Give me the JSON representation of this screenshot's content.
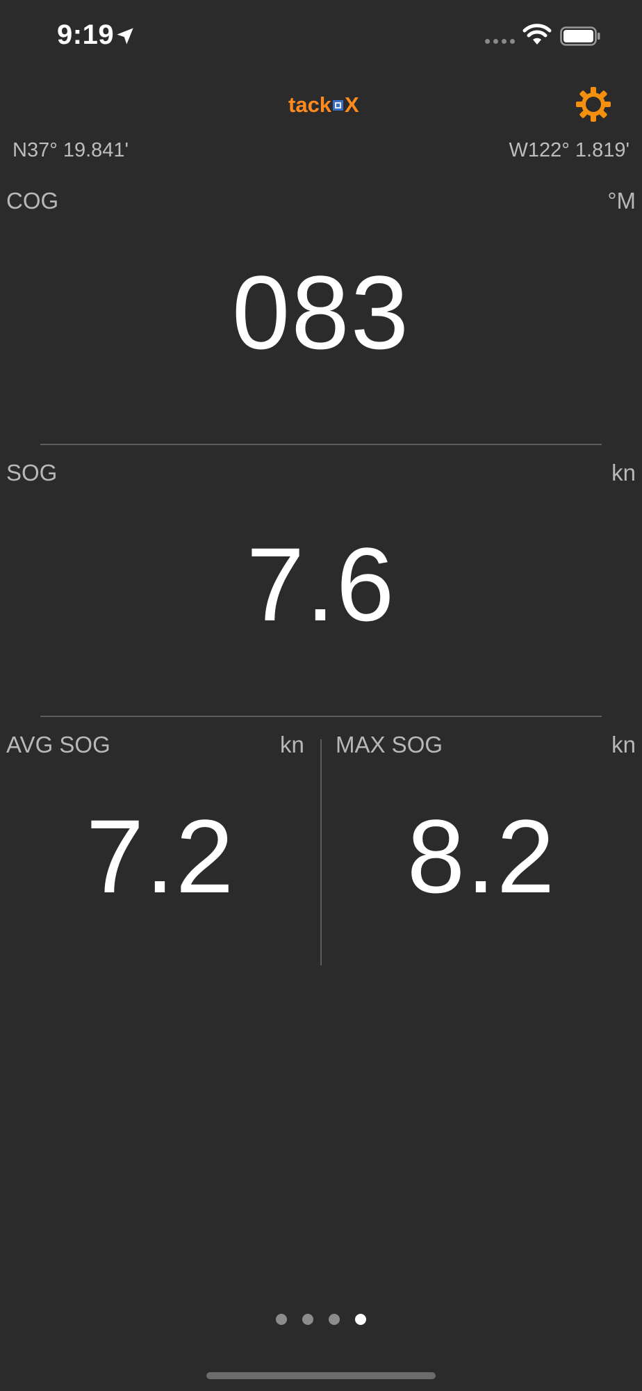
{
  "status_bar": {
    "time": "9:19",
    "location_icon": "location-arrow-icon",
    "wifi_icon": "wifi-icon",
    "battery_icon": "battery-icon"
  },
  "header": {
    "logo_left": "tack",
    "logo_right": "X",
    "settings_icon": "gear-icon",
    "accent_color": "#ff8a1f"
  },
  "position": {
    "latitude": "N37° 19.841'",
    "longitude": "W122° 1.819'"
  },
  "cog": {
    "label": "COG",
    "unit": "°M",
    "value": "083"
  },
  "sog": {
    "label": "SOG",
    "unit": "kn",
    "value": "7.6"
  },
  "avg_sog": {
    "label": "AVG SOG",
    "unit": "kn",
    "value": "7.2"
  },
  "max_sog": {
    "label": "MAX SOG",
    "unit": "kn",
    "value": "8.2"
  },
  "pager": {
    "pages": 4,
    "current": 4
  }
}
